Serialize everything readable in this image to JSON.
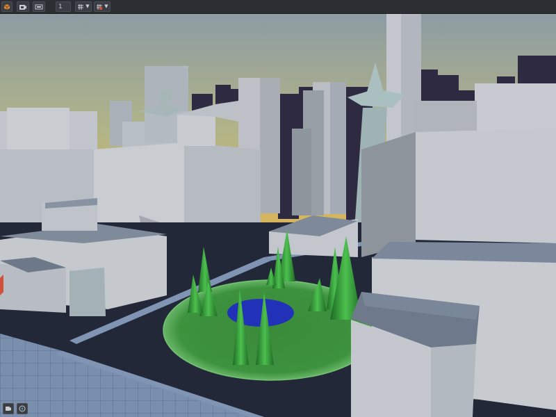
{
  "toolbar": {
    "buttons": [
      {
        "name": "view-cube-icon"
      },
      {
        "name": "camera-icon"
      },
      {
        "name": "screen-icon"
      }
    ],
    "speed_value": "1",
    "grid_dropdown": {
      "icon": "grid-icon"
    },
    "snap_dropdown": {
      "icon": "snap-grid-icon"
    }
  },
  "bottom_bar": {
    "buttons": [
      {
        "name": "camera-toggle-icon"
      },
      {
        "name": "compass-icon"
      }
    ]
  },
  "colors": {
    "sky_top": "#8d9ca3",
    "sky_horizon": "#d9b55a",
    "buildings_light": "#c9cdd3",
    "buildings_shade": "#9aa3ad",
    "buildings_dark": "#2e2a42",
    "ground": "#24283a",
    "park": "#3f8f3f",
    "pond": "#2232b8",
    "trees": "#2e8a34",
    "sidewalk": "#7f95b3"
  }
}
